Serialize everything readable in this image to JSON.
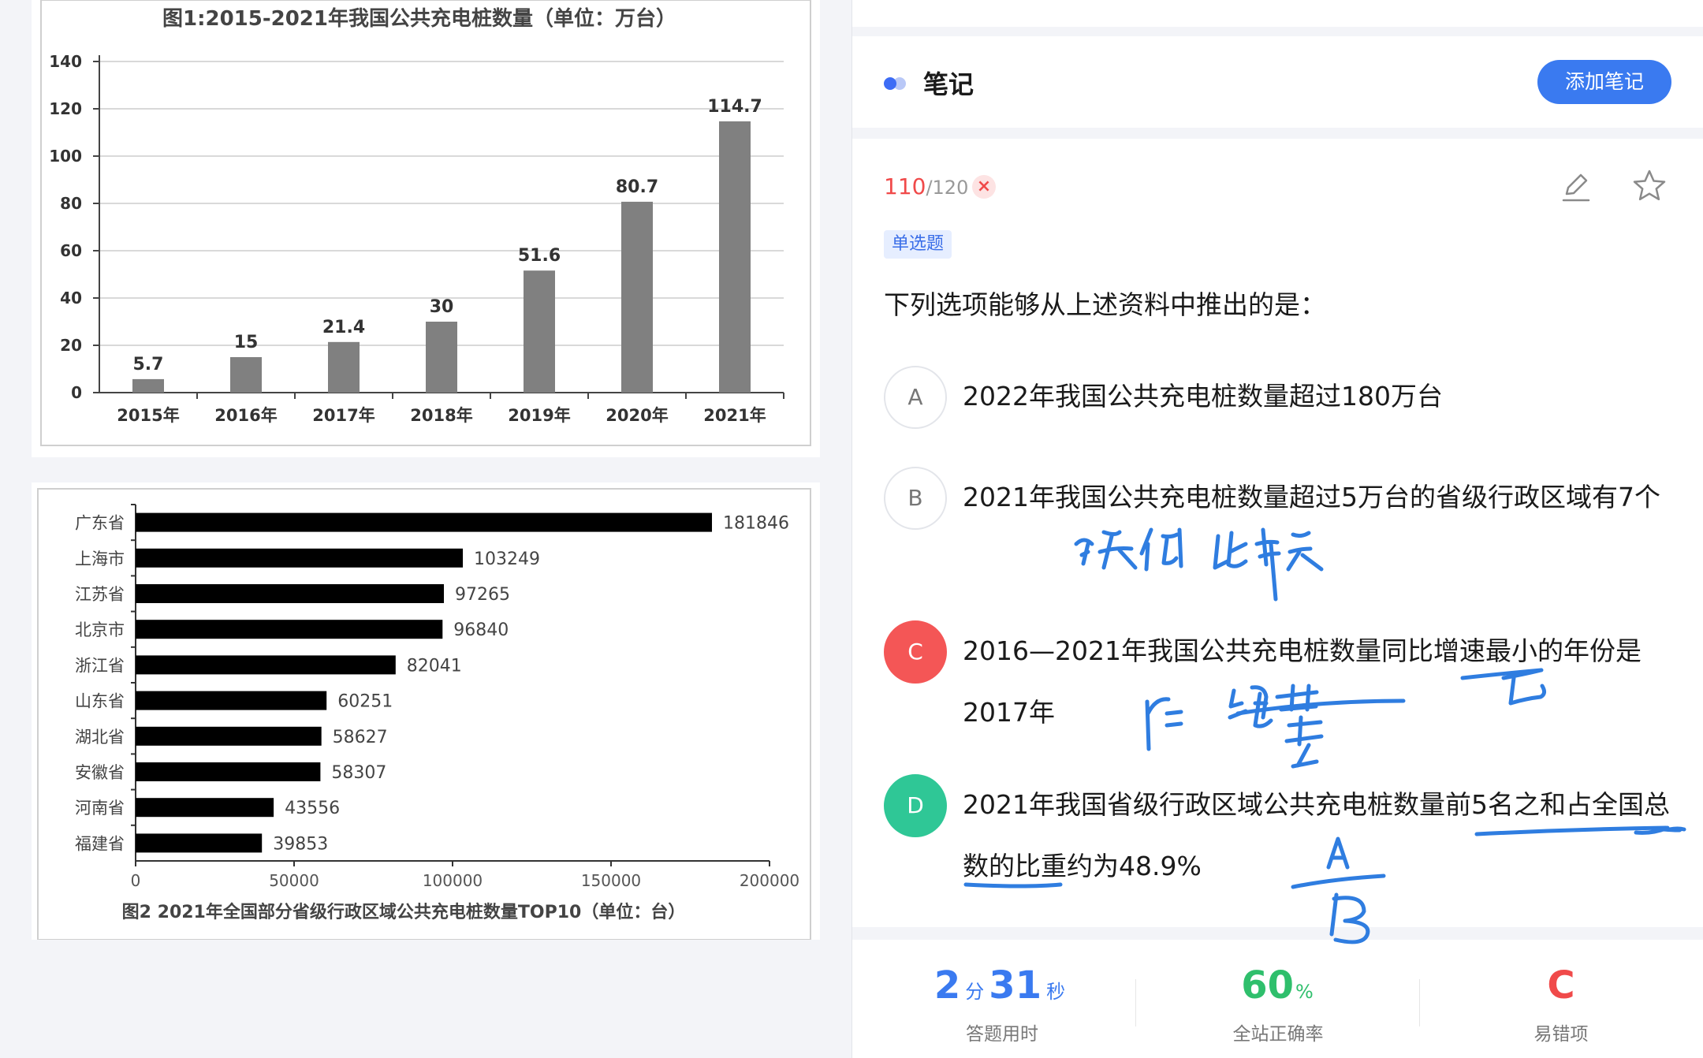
{
  "chart_data": [
    {
      "type": "bar",
      "title": "图1:2015-2021年我国公共充电桩数量（单位：万台）",
      "categories": [
        "2015年",
        "2016年",
        "2017年",
        "2018年",
        "2019年",
        "2020年",
        "2021年"
      ],
      "values": [
        5.7,
        15,
        21.4,
        30,
        51.6,
        80.7,
        114.7
      ],
      "value_labels": [
        "5.7",
        "15",
        "21.4",
        "30",
        "51.6",
        "80.7",
        "114.7"
      ],
      "yticks": [
        "0",
        "20",
        "40",
        "60",
        "80",
        "100",
        "120",
        "140"
      ],
      "ylim": [
        0,
        140
      ],
      "bar_color": "#808080",
      "grid": true
    },
    {
      "type": "bar",
      "orientation": "horizontal",
      "title": "图2 2021年全国部分省级行政区域公共充电桩数量TOP10（单位：台）",
      "categories": [
        "广东省",
        "上海市",
        "江苏省",
        "北京市",
        "浙江省",
        "山东省",
        "湖北省",
        "安徽省",
        "河南省",
        "福建省"
      ],
      "values": [
        181846,
        103249,
        97265,
        96840,
        82041,
        60251,
        58627,
        58307,
        43556,
        39853
      ],
      "value_labels": [
        "181846",
        "103249",
        "97265",
        "96840",
        "82041",
        "60251",
        "58627",
        "58307",
        "43556",
        "39853"
      ],
      "xticks": [
        "0",
        "50000",
        "100000",
        "150000",
        "200000"
      ],
      "xlim": [
        0,
        200000
      ],
      "bar_color": "#000000"
    }
  ],
  "notes": {
    "title": "笔记",
    "add_button": "添加笔记"
  },
  "question": {
    "current": "110",
    "total": "/120",
    "wrong_mark": "×",
    "type_tag": "单选题",
    "stem": "下列选项能够从上述资料中推出的是：",
    "options": [
      {
        "letter": "A",
        "text": "2022年我国公共充电桩数量超过180万台"
      },
      {
        "letter": "B",
        "text": "2021年我国公共充电桩数量超过5万台的省级行政区域有7个"
      },
      {
        "letter": "C",
        "text": "2016—2021年我国公共充电桩数量同比增速最小的年份是2017年"
      },
      {
        "letter": "D",
        "text": "2021年我国省级行政区域公共充电桩数量前5名之和占全国总数的比重约为48.9%"
      }
    ]
  },
  "stats": {
    "time_min": "2",
    "time_min_unit": "分",
    "time_sec": "31",
    "time_sec_unit": "秒",
    "time_label": "答题用时",
    "accuracy": "60",
    "accuracy_unit": "%",
    "accuracy_label": "全站正确率",
    "mistake": "C",
    "mistake_label": "易错项"
  },
  "colors": {
    "accent": "#3a7af0",
    "wrong": "#f04a4a",
    "correct": "#2fc796",
    "ink": "#2f7de0"
  },
  "icons": [
    "notes-dots-icon",
    "wrong-x-icon",
    "edit-icon",
    "star-icon"
  ]
}
